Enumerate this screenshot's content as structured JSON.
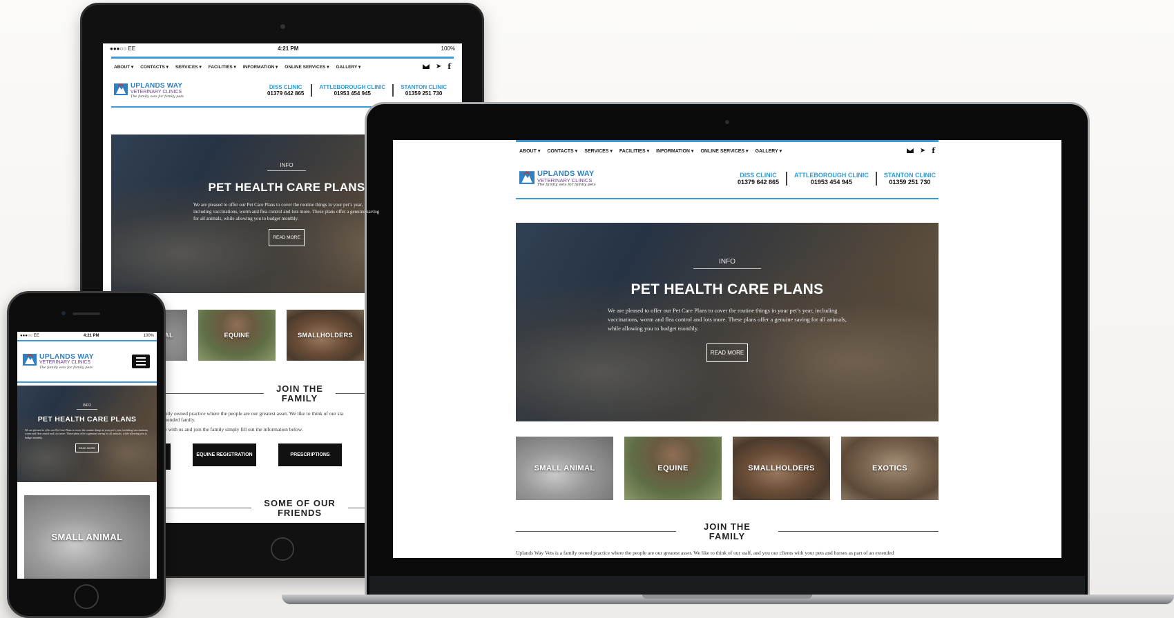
{
  "nav": [
    "ABOUT ▾",
    "CONTACTS ▾",
    "SERVICES ▾",
    "FACILITIES ▾",
    "INFORMATION ▾",
    "ONLINE SERVICES ▾",
    "GALLERY ▾"
  ],
  "logo": {
    "line1": "UPLANDS WAY",
    "line2": "VETERINARY CLINICS",
    "tagline": "The family vets for family pets"
  },
  "clinics": [
    {
      "name": "DISS CLINIC",
      "phone": "01379 642 865"
    },
    {
      "name": "ATTLEBOROUGH CLINIC",
      "phone": "01953 454 945"
    },
    {
      "name": "STANTON CLINIC",
      "phone": "01359 251 730"
    }
  ],
  "hero": {
    "eyebrow": "INFO",
    "divider_glyph": "×",
    "title": "PET HEALTH CARE PLANS",
    "body": "We are pleased to offer our Pet Care Plans to cover the routine things in your pet’s year, including vaccinations, worm and flea control and lots more. These plans offer a genuine saving for all animals, while allowing you to budget monthly.",
    "button": "READ MORE"
  },
  "tiles": [
    "SMALL ANIMAL",
    "EQUINE",
    "SMALLHOLDERS",
    "EXOTICS"
  ],
  "tablet_tiles": [
    "AL",
    "EQUINE",
    "SMALLHOLDERS"
  ],
  "join": {
    "title_line1": "JOIN THE",
    "title_line2": "FAMILY",
    "text": "Uplands Way Vets is a family owned practice where the people are our greatest asset. We like to think of our staff, and you our clients with your pets and horses as part of an extended",
    "tablet_text1": "amily owned practice where the people are our greatest asset. We like to think of our sta",
    "tablet_text2": "extended family.",
    "tablet_text3": "rse with us and join the family simply fill out the information below.",
    "buttons": [
      "EQUINE REGISTRATION",
      "PRESCRIPTIONS"
    ]
  },
  "friends": {
    "line1": "SOME OF OUR",
    "line2": "FRIENDS"
  },
  "tablet_status": {
    "carrier": "●●●○○ EE",
    "time": "4:21 PM",
    "battery": "100%"
  },
  "phone_status": {
    "carrier": "●●●○○ EE",
    "time": "4:21 PM",
    "battery": "100%"
  },
  "icons": {
    "mail": "mail-icon",
    "twitter": "twitter-icon",
    "facebook": "facebook-icon",
    "menu": "hamburger-menu-icon"
  },
  "colors": {
    "accent": "#3a9ad9",
    "logo_blue": "#2f7fc1",
    "logo_purple": "#6b3f8c"
  }
}
